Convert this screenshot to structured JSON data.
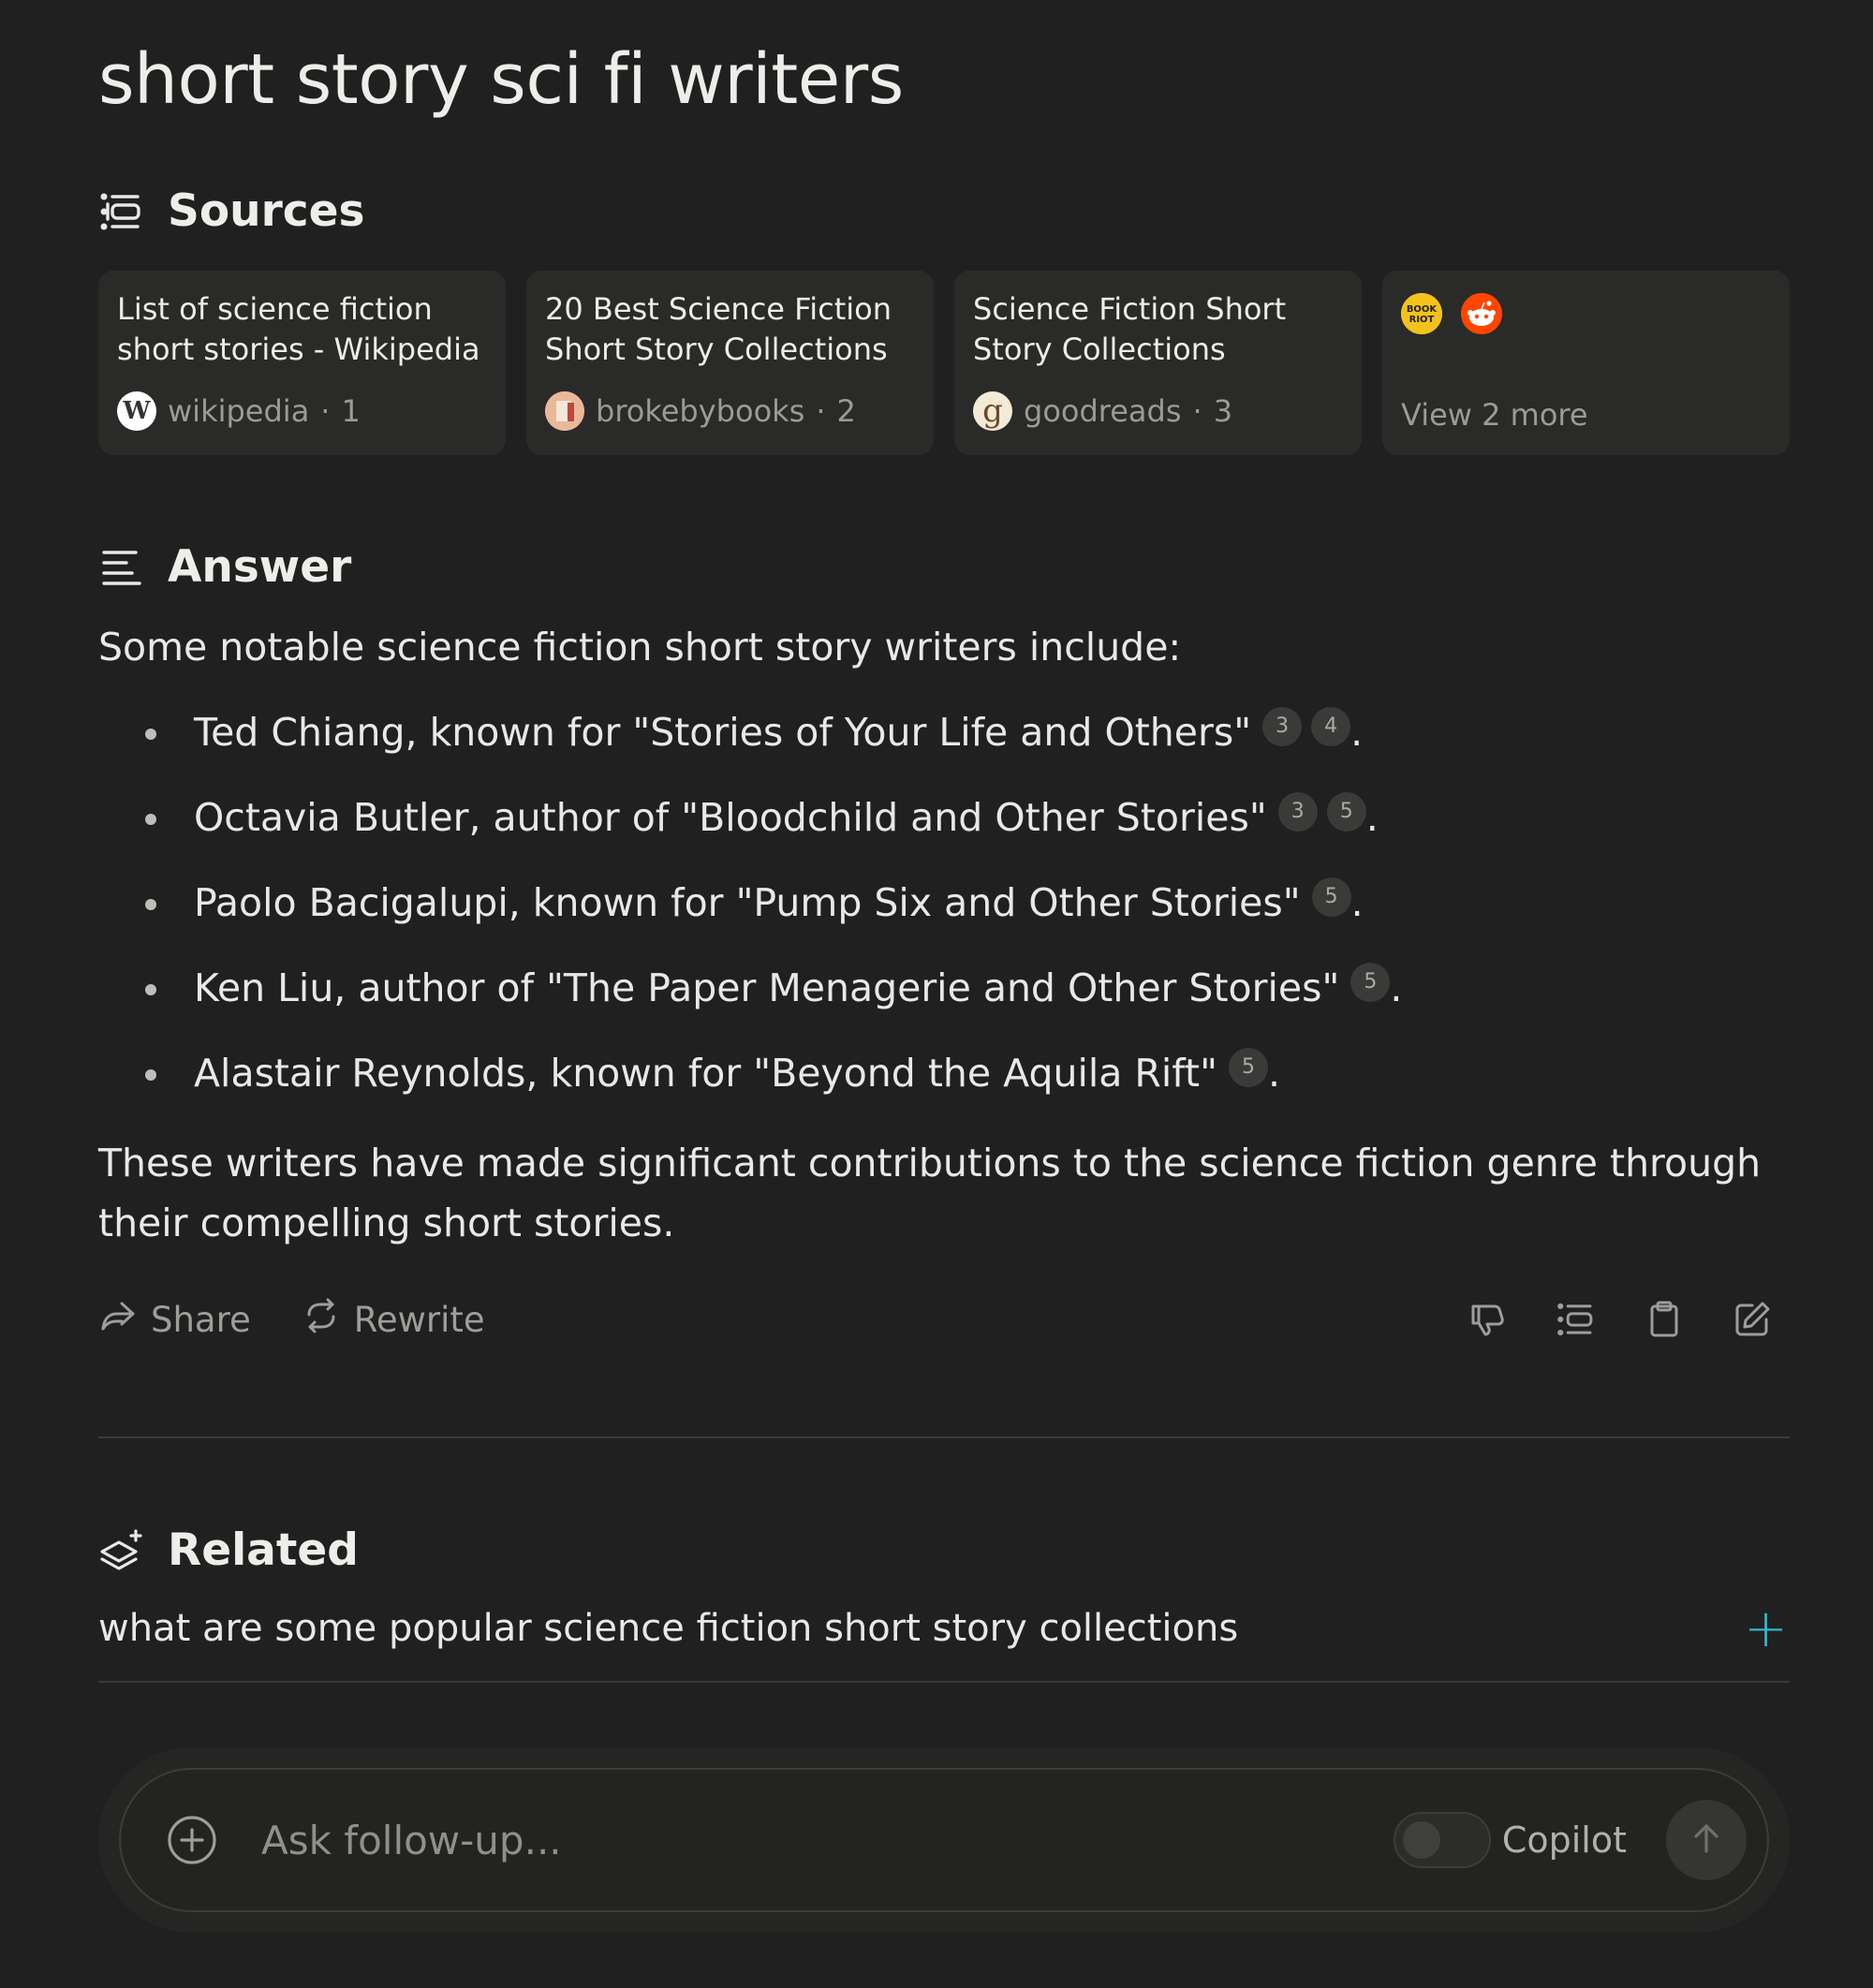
{
  "query": "short story sci fi writers",
  "sources": {
    "heading": "Sources",
    "cards": [
      {
        "title": "List of science fiction short stories - Wikipedia",
        "site": "wikipedia",
        "index": "1",
        "favicon": "W"
      },
      {
        "title": "20 Best Science Fiction Short Story Collections ...",
        "site": "brokebybooks",
        "index": "2",
        "favicon": "BROKE BY BOOKS"
      },
      {
        "title": "Science Fiction Short Story Collections",
        "site": "goodreads",
        "index": "3",
        "favicon": "g"
      }
    ],
    "more": {
      "label": "View 2 more",
      "icons": [
        "book-riot-icon",
        "reddit-icon"
      ]
    }
  },
  "answer": {
    "heading": "Answer",
    "intro": "Some notable science fiction short story writers include:",
    "items": [
      {
        "text": "Ted Chiang, known for \"Stories of Your Life and Others\"",
        "cites": [
          "3",
          "4"
        ]
      },
      {
        "text": "Octavia Butler, author of \"Bloodchild and Other Stories\"",
        "cites": [
          "3",
          "5"
        ]
      },
      {
        "text": "Paolo Bacigalupi, known for \"Pump Six and Other Stories\"",
        "cites": [
          "5"
        ]
      },
      {
        "text": "Ken Liu, author of \"The Paper Menagerie and Other Stories\"",
        "cites": [
          "5"
        ]
      },
      {
        "text": "Alastair Reynolds, known for \"Beyond the Aquila Rift\"",
        "cites": [
          "5"
        ]
      }
    ],
    "outro": "These writers have made significant contributions to the science fiction genre through their compelling short stories.",
    "actions": {
      "share": "Share",
      "rewrite": "Rewrite"
    }
  },
  "related": {
    "heading": "Related",
    "items": [
      {
        "text": "what are some popular science fiction short story collections"
      }
    ]
  },
  "followup": {
    "placeholder": "Ask follow-up...",
    "copilot_label": "Copilot"
  },
  "colors": {
    "background": "#202020",
    "card": "#2a2a29",
    "accent": "#2fb8cf"
  }
}
